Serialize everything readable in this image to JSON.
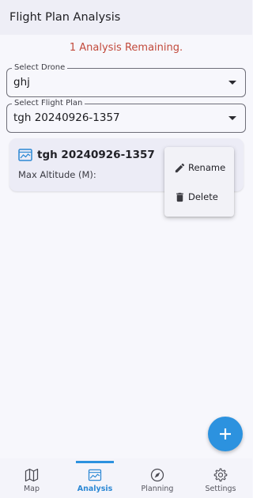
{
  "app_bar": {
    "title": "Flight Plan Analysis"
  },
  "remaining_text": "1 Analysis Remaining.",
  "drone_select": {
    "label": "Select Drone",
    "value": "ghj"
  },
  "flight_plan_select": {
    "label": "Select Flight Plan",
    "value": "tgh 20240926-1357"
  },
  "card": {
    "title": "tgh 20240926-1357",
    "max_altitude_label": "Max Altitude (M):"
  },
  "popup_menu": {
    "rename_label": "Rename",
    "delete_label": "Delete"
  },
  "bottom_nav": {
    "items": [
      {
        "label": "Map",
        "icon": "map-icon"
      },
      {
        "label": "Analysis",
        "icon": "analysis-icon"
      },
      {
        "label": "Planning",
        "icon": "navigation-icon"
      },
      {
        "label": "Settings",
        "icon": "gear-icon"
      }
    ],
    "active": "Analysis"
  },
  "colors": {
    "accent": "#2c92df",
    "warning_text": "#c24a3c",
    "app_bar": "#eeeef6",
    "background": "#f7f7fc"
  }
}
